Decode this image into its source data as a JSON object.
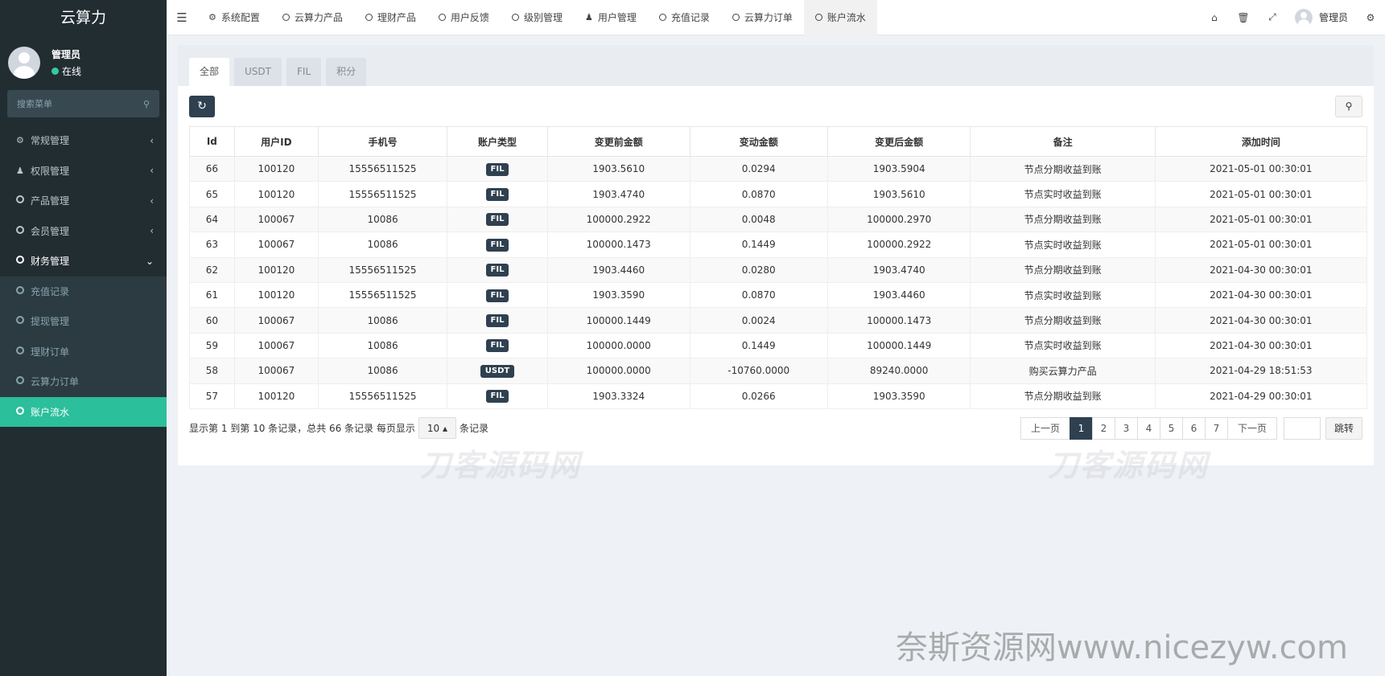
{
  "brand": "云算力",
  "user": {
    "name": "管理员",
    "status": "在线"
  },
  "sidebar": {
    "search_placeholder": "搜索菜单",
    "items": [
      {
        "label": "常规管理",
        "icon": "gears-icon"
      },
      {
        "label": "权限管理",
        "icon": "users-icon"
      },
      {
        "label": "产品管理",
        "icon": "circle-icon"
      },
      {
        "label": "会员管理",
        "icon": "circle-icon"
      },
      {
        "label": "财务管理",
        "icon": "circle-icon"
      }
    ],
    "sub_items": [
      {
        "label": "充值记录"
      },
      {
        "label": "提现管理"
      },
      {
        "label": "理财订单"
      },
      {
        "label": "云算力订单"
      },
      {
        "label": "账户流水"
      }
    ]
  },
  "topnav": [
    {
      "label": "系统配置",
      "icon": "gear-icon"
    },
    {
      "label": "云算力产品",
      "icon": "circle-icon"
    },
    {
      "label": "理财产品",
      "icon": "circle-icon"
    },
    {
      "label": "用户反馈",
      "icon": "circle-icon"
    },
    {
      "label": "级别管理",
      "icon": "circle-icon"
    },
    {
      "label": "用户管理",
      "icon": "user-icon"
    },
    {
      "label": "充值记录",
      "icon": "circle-icon"
    },
    {
      "label": "云算力订单",
      "icon": "circle-icon"
    },
    {
      "label": "账户流水",
      "icon": "circle-icon"
    }
  ],
  "topright": {
    "user": "管理员"
  },
  "tabs": [
    "全部",
    "USDT",
    "FIL",
    "积分"
  ],
  "table": {
    "headers": [
      "Id",
      "用户ID",
      "手机号",
      "账户类型",
      "变更前金额",
      "变动金额",
      "变更后金额",
      "备注",
      "添加时间"
    ],
    "rows": [
      [
        "66",
        "100120",
        "15556511525",
        "FIL",
        "1903.5610",
        "0.0294",
        "1903.5904",
        "节点分期收益到账",
        "2021-05-01 00:30:01"
      ],
      [
        "65",
        "100120",
        "15556511525",
        "FIL",
        "1903.4740",
        "0.0870",
        "1903.5610",
        "节点实时收益到账",
        "2021-05-01 00:30:01"
      ],
      [
        "64",
        "100067",
        "10086",
        "FIL",
        "100000.2922",
        "0.0048",
        "100000.2970",
        "节点分期收益到账",
        "2021-05-01 00:30:01"
      ],
      [
        "63",
        "100067",
        "10086",
        "FIL",
        "100000.1473",
        "0.1449",
        "100000.2922",
        "节点实时收益到账",
        "2021-05-01 00:30:01"
      ],
      [
        "62",
        "100120",
        "15556511525",
        "FIL",
        "1903.4460",
        "0.0280",
        "1903.4740",
        "节点分期收益到账",
        "2021-04-30 00:30:01"
      ],
      [
        "61",
        "100120",
        "15556511525",
        "FIL",
        "1903.3590",
        "0.0870",
        "1903.4460",
        "节点实时收益到账",
        "2021-04-30 00:30:01"
      ],
      [
        "60",
        "100067",
        "10086",
        "FIL",
        "100000.1449",
        "0.0024",
        "100000.1473",
        "节点分期收益到账",
        "2021-04-30 00:30:01"
      ],
      [
        "59",
        "100067",
        "10086",
        "FIL",
        "100000.0000",
        "0.1449",
        "100000.1449",
        "节点实时收益到账",
        "2021-04-30 00:30:01"
      ],
      [
        "58",
        "100067",
        "10086",
        "USDT",
        "100000.0000",
        "-10760.0000",
        "89240.0000",
        "购买云算力产品",
        "2021-04-29 18:51:53"
      ],
      [
        "57",
        "100120",
        "15556511525",
        "FIL",
        "1903.3324",
        "0.0266",
        "1903.3590",
        "节点分期收益到账",
        "2021-04-29 00:30:01"
      ]
    ]
  },
  "footer": {
    "summary_prefix": "显示第 1 到第 10 条记录，总共 66 条记录 每页显示",
    "page_size": "10",
    "summary_suffix": "条记录",
    "prev": "上一页",
    "pages": [
      "1",
      "2",
      "3",
      "4",
      "5",
      "6",
      "7"
    ],
    "next": "下一页",
    "jump": "跳转"
  },
  "watermarks": {
    "center": "刀客源码网",
    "bottom": "奈斯资源网www.nicezyw.com"
  }
}
